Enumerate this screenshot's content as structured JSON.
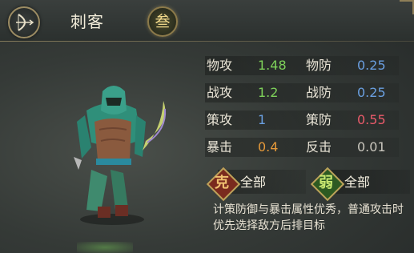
{
  "header": {
    "class_name": "刺客",
    "rank": "叁",
    "class_icon": "bow-icon"
  },
  "stats": [
    {
      "label": "物攻",
      "value": "1.48",
      "color": "#7ed15a"
    },
    {
      "label": "战攻",
      "value": "1.2",
      "color": "#7ed15a"
    },
    {
      "label": "策攻",
      "value": "1",
      "color": "#6a9fe0"
    },
    {
      "label": "暴击",
      "value": "0.4",
      "color": "#e69a3a"
    }
  ],
  "stats_right": [
    {
      "label": "物防",
      "value": "0.25",
      "color": "#6a9fe0"
    },
    {
      "label": "战防",
      "value": "0.25",
      "color": "#6a9fe0"
    },
    {
      "label": "策防",
      "value": "0.55",
      "color": "#e85a6a"
    },
    {
      "label": "反击",
      "value": "0.01",
      "color": "#c9c6bd"
    }
  ],
  "counters": {
    "strong": {
      "badge": "克",
      "text": "全部",
      "color": "#e8a040"
    },
    "weak": {
      "badge": "弱",
      "text": "全部",
      "color": "#8fd050"
    }
  },
  "description": "计策防御与暴击属性优秀，普通攻击时优先选择敌方后排目标"
}
